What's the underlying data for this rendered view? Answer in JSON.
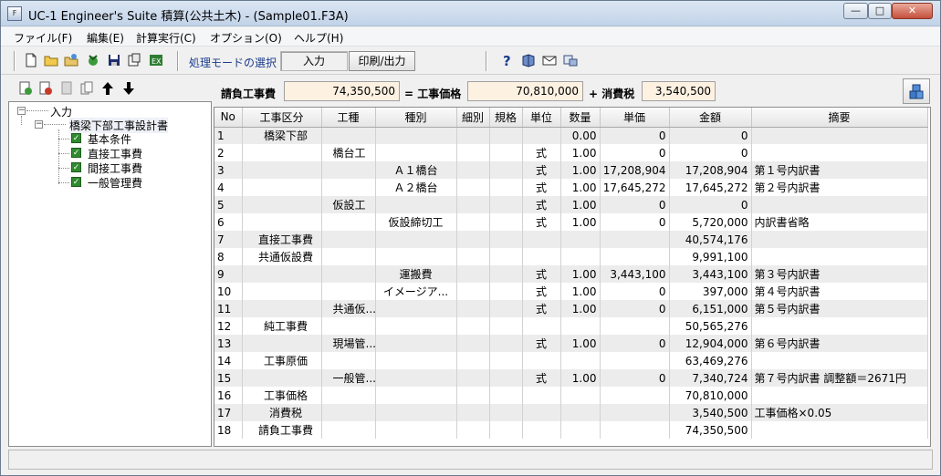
{
  "window": {
    "title": "UC-1 Engineer's Suite 積算(公共土木) - (Sample01.F3A)",
    "app_icon_text": "F",
    "min_label": "—",
    "max_label": "□",
    "close_label": "✕"
  },
  "menu": [
    "ファイル(F)",
    "編集(E)",
    "計算実行(C)",
    "オプション(O)",
    "ヘルプ(H)"
  ],
  "toolbar": {
    "icons": [
      "new-file-icon",
      "open-folder-icon",
      "open-sample-icon",
      "import-icon",
      "save-icon",
      "save-as-icon",
      "export-icon"
    ],
    "mode_label": "処理モードの選択",
    "mode_input": "入力",
    "mode_print": "印刷/出力",
    "help_icons": [
      "help-icon",
      "manual-icon",
      "mail-icon",
      "about-icon"
    ]
  },
  "left_toolbar": {
    "icons": [
      "insert-node-icon",
      "delete-node-icon",
      "disabled-node-icon",
      "copy-node-icon",
      "move-up-icon",
      "move-down-icon"
    ]
  },
  "tree": {
    "root": "入力",
    "child": "橋梁下部工事設計書",
    "items": [
      "基本条件",
      "直接工事費",
      "間接工事費",
      "一般管理費"
    ]
  },
  "summary": {
    "contract_label": "請負工事費",
    "contract_value": "74,350,500",
    "eq_label": "= 工事価格",
    "price_value": "70,810,000",
    "plus_label": "+ 消費税",
    "tax_value": "3,540,500"
  },
  "grid": {
    "headers": [
      "No",
      "工事区分",
      "工種",
      "種別",
      "細別",
      "規格",
      "単位",
      "数量",
      "単価",
      "金額",
      "摘要"
    ],
    "rows": [
      [
        "1",
        "橋梁下部",
        "",
        "",
        "",
        "",
        "",
        "0.00",
        "0",
        "0",
        ""
      ],
      [
        "2",
        "",
        "橋台工",
        "",
        "",
        "",
        "式",
        "1.00",
        "0",
        "0",
        ""
      ],
      [
        "3",
        "",
        "",
        "Ａ１橋台",
        "",
        "",
        "式",
        "1.00",
        "17,208,904",
        "17,208,904",
        "第１号内訳書"
      ],
      [
        "4",
        "",
        "",
        "Ａ２橋台",
        "",
        "",
        "式",
        "1.00",
        "17,645,272",
        "17,645,272",
        "第２号内訳書"
      ],
      [
        "5",
        "",
        "仮設工",
        "",
        "",
        "",
        "式",
        "1.00",
        "0",
        "0",
        ""
      ],
      [
        "6",
        "",
        "",
        "仮設締切工",
        "",
        "",
        "式",
        "1.00",
        "0",
        "5,720,000",
        "内訳書省略"
      ],
      [
        "7",
        "直接工事費",
        "",
        "",
        "",
        "",
        "",
        "",
        "",
        "40,574,176",
        ""
      ],
      [
        "8",
        "共通仮設費",
        "",
        "",
        "",
        "",
        "",
        "",
        "",
        "9,991,100",
        ""
      ],
      [
        "9",
        "",
        "",
        "運搬費",
        "",
        "",
        "式",
        "1.00",
        "3,443,100",
        "3,443,100",
        "第３号内訳書"
      ],
      [
        "10",
        "",
        "",
        "イメージア...",
        "",
        "",
        "式",
        "1.00",
        "0",
        "397,000",
        "第４号内訳書"
      ],
      [
        "11",
        "",
        "共通仮...",
        "",
        "",
        "",
        "式",
        "1.00",
        "0",
        "6,151,000",
        "第５号内訳書"
      ],
      [
        "12",
        "純工事費",
        "",
        "",
        "",
        "",
        "",
        "",
        "",
        "50,565,276",
        ""
      ],
      [
        "13",
        "",
        "現場管...",
        "",
        "",
        "",
        "式",
        "1.00",
        "0",
        "12,904,000",
        "第６号内訳書"
      ],
      [
        "14",
        "工事原価",
        "",
        "",
        "",
        "",
        "",
        "",
        "",
        "63,469,276",
        ""
      ],
      [
        "15",
        "",
        "一般管...",
        "",
        "",
        "",
        "式",
        "1.00",
        "0",
        "7,340,724",
        "第７号内訳書 調整額＝2671円"
      ],
      [
        "16",
        "工事価格",
        "",
        "",
        "",
        "",
        "",
        "",
        "",
        "70,810,000",
        ""
      ],
      [
        "17",
        "消費税",
        "",
        "",
        "",
        "",
        "",
        "",
        "",
        "3,540,500",
        "工事価格×0.05"
      ],
      [
        "18",
        "請負工事費",
        "",
        "",
        "",
        "",
        "",
        "",
        "",
        "74,350,500",
        ""
      ]
    ]
  },
  "colors": {
    "field_bg": "#fdf1e2",
    "row_shade": "#ececec",
    "check_green": "#2f8a2f"
  }
}
